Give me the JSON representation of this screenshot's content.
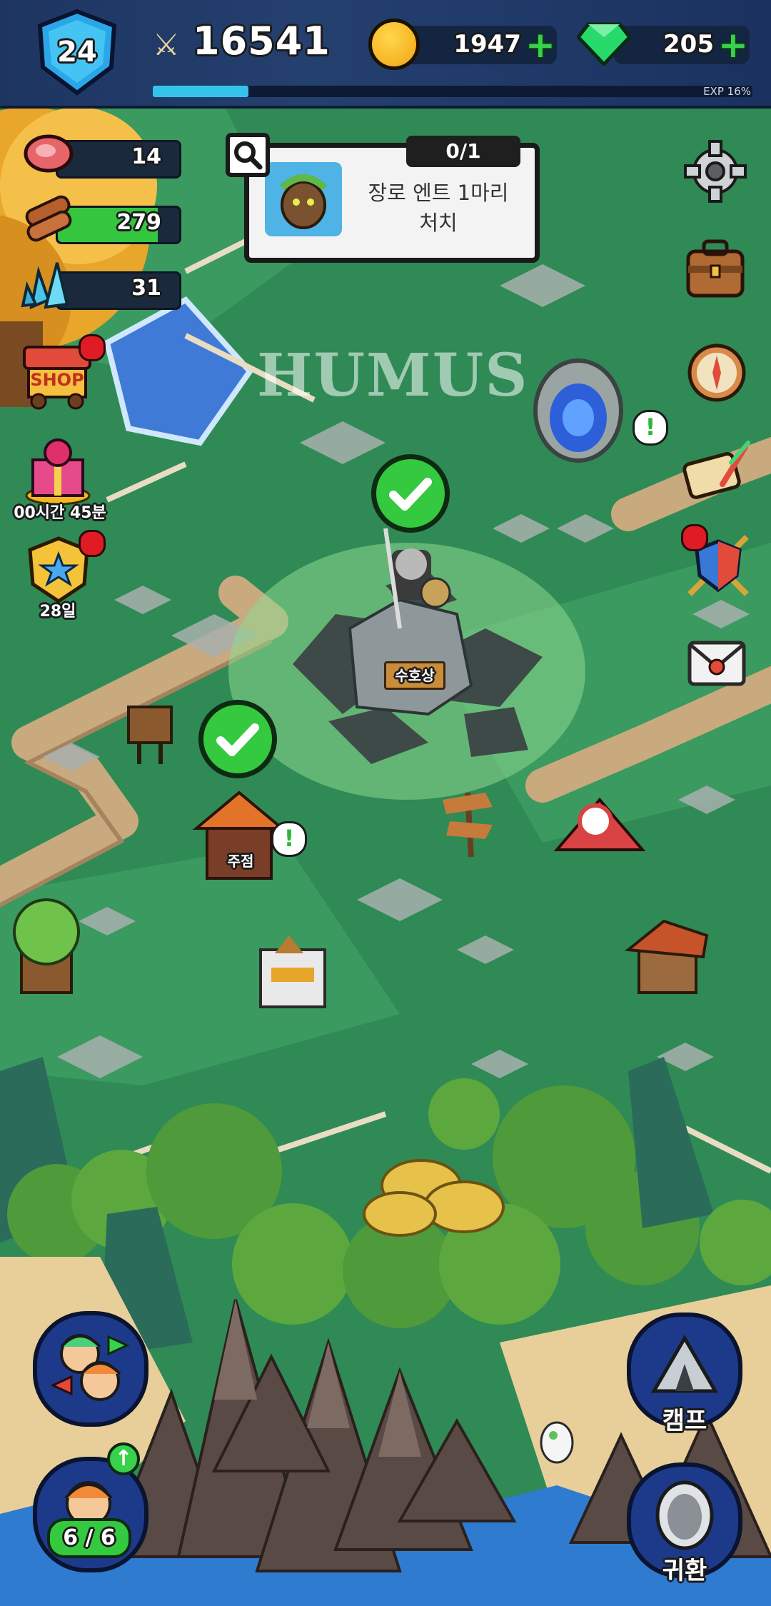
{
  "header": {
    "level": "24",
    "combat_power": "16541",
    "gold": "1947",
    "gems": "205",
    "exp_label": "EXP 16%",
    "exp_progress": 0.16
  },
  "resources": {
    "meat": "14",
    "wood": "279",
    "crystal": "31"
  },
  "quest": {
    "title": "장로 엔트 1마리 처치",
    "progress": "0/1"
  },
  "watermark": "HUMUS",
  "left_menu": {
    "shop_label": "SHOP",
    "gift_timer": "00시간 45분",
    "pass_days": "28일"
  },
  "map_labels": {
    "guardian_statue": "수호상",
    "tavern": "주점"
  },
  "bottom": {
    "party_count": "6 / 6",
    "camp_label": "캠프",
    "return_label": "귀환"
  },
  "colors": {
    "accent_green": "#37d14b",
    "alert_red": "#e01b24",
    "topbar_blue": "#1e3561",
    "exp_cyan": "#35c3ec"
  }
}
